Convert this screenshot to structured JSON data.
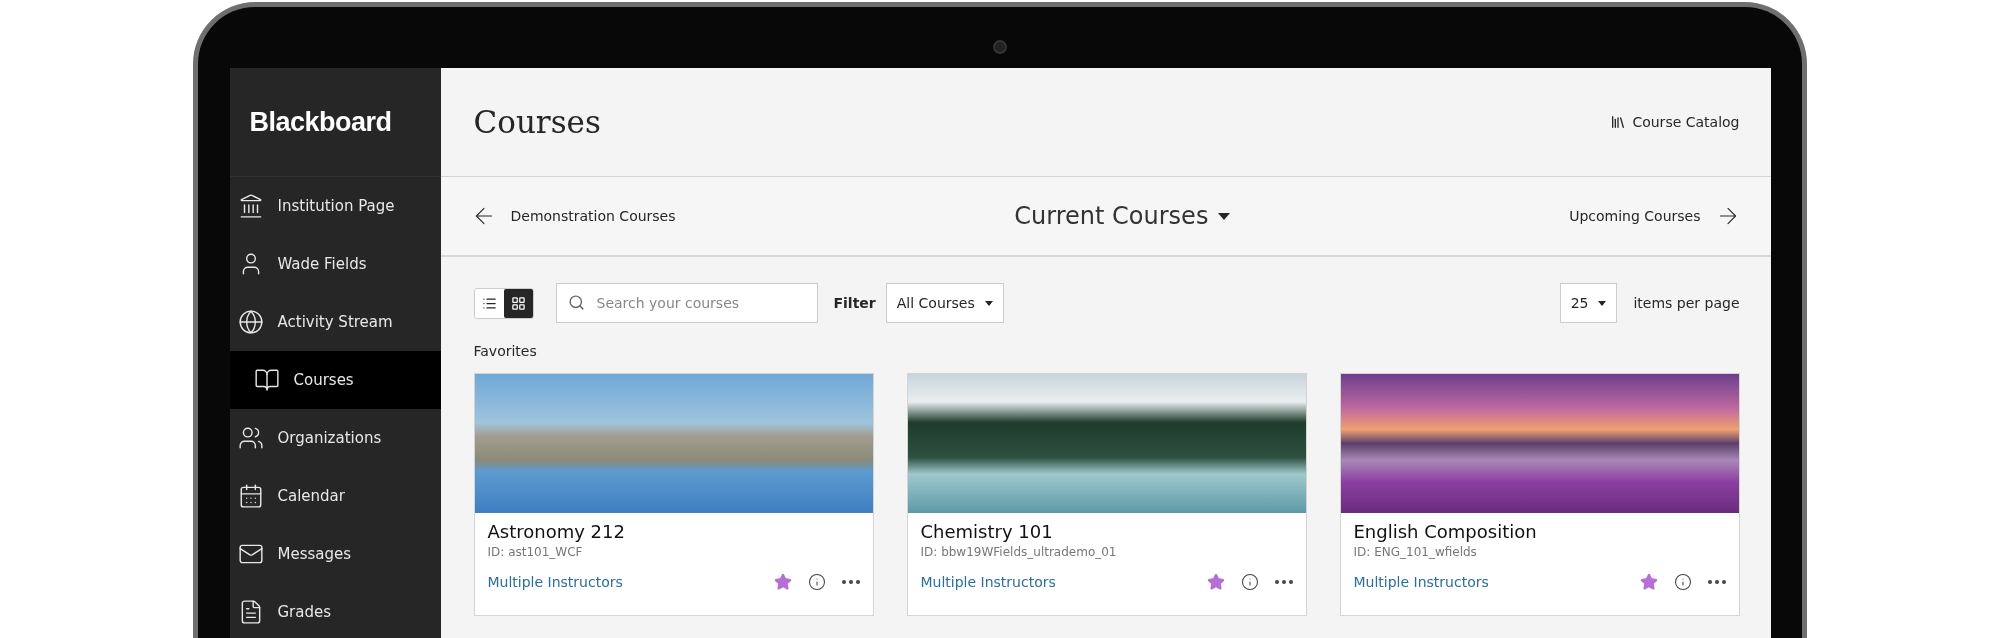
{
  "logo": "Blackboard",
  "sidebar": {
    "items": [
      {
        "label": "Institution Page",
        "selected": false
      },
      {
        "label": "Wade Fields",
        "selected": false
      },
      {
        "label": "Activity Stream",
        "selected": false
      },
      {
        "label": "Courses",
        "selected": true
      },
      {
        "label": "Organizations",
        "selected": false
      },
      {
        "label": "Calendar",
        "selected": false
      },
      {
        "label": "Messages",
        "selected": false
      },
      {
        "label": "Grades",
        "selected": false
      }
    ]
  },
  "header": {
    "title": "Courses",
    "catalog_link": "Course Catalog"
  },
  "term_nav": {
    "previous": "Demonstration Courses",
    "current": "Current Courses",
    "next": "Upcoming Courses"
  },
  "toolbar": {
    "view_modes": [
      {
        "kind": "list",
        "selected": false
      },
      {
        "kind": "grid",
        "selected": true
      }
    ],
    "search": {
      "placeholder": "Search your courses"
    },
    "filter_label": "Filter",
    "filter_value": "All Courses",
    "per_page_value": "25",
    "per_page_label": "items per page"
  },
  "section_title": "Favorites",
  "cards": [
    {
      "title": "Astronomy 212",
      "id": "ID: ast101_WCF",
      "instructors": "Multiple Instructors",
      "favorite": true
    },
    {
      "title": "Chemistry 101",
      "id": "ID: bbw19WFields_ultrademo_01",
      "instructors": "Multiple Instructors",
      "favorite": true
    },
    {
      "title": "English Composition",
      "id": "ID: ENG_101_wfields",
      "instructors": "Multiple Instructors",
      "favorite": true
    }
  ]
}
